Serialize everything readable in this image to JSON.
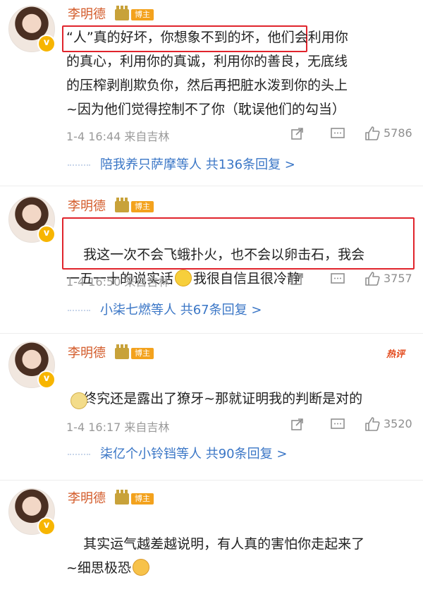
{
  "comments": [
    {
      "author": "李明德",
      "badge": "博主",
      "verified": "v",
      "text": "“人”真的好坏，你想象不到的坏，他们会利用你\n的真心，利用你的真诚，利用你的善良，无底线\n的压榨剥削欺负你，然后再把脏水泼到你的头上\n~因为他们觉得控制不了你（耽误他们的勾当）",
      "meta": "1-4 16:44 来自吉林",
      "likes": "5786",
      "reply_text": "陪我养只萨摩等人 共136条回复 >"
    },
    {
      "author": "李明德",
      "badge": "博主",
      "verified": "v",
      "text": "我这一次不会飞蛾扑火，也不会以卵击石，我会\n一五一十的说实话",
      "text_after_emoji": "我很自信且很冷静",
      "meta": "1-4 16:50 来自吉林",
      "likes": "3757",
      "reply_text": "小柒七燃等人 共67条回复 >"
    },
    {
      "author": "李明德",
      "badge": "博主",
      "verified": "v",
      "tag": "热评",
      "text": "终究还是露出了獠牙~那就证明我的判断是对的",
      "meta": "1-4 16:17 来自吉林",
      "likes": "3520",
      "reply_text": "柒亿个小铃铛等人 共90条回复 >"
    },
    {
      "author": "李明德",
      "badge": "博主",
      "verified": "v",
      "text": "其实运气越差越说明，有人真的害怕你走起来了\n~细思极恐"
    }
  ],
  "icons": {
    "share": "share-icon",
    "comment": "comment-icon",
    "like": "like-icon"
  },
  "colors": {
    "author": "#d35b2a",
    "highlight_border": "#e0242c",
    "reply_link": "#3a76c6",
    "badge_bg": "#f3a21d",
    "verified_bg": "#f7b500"
  }
}
